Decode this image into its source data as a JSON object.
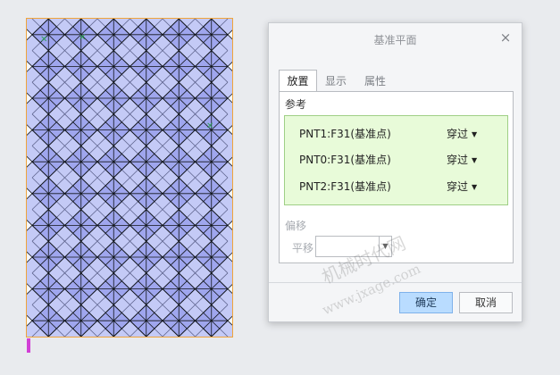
{
  "dialog": {
    "title": "基准平面",
    "close_glyph": "×",
    "tabs": [
      {
        "label": "放置",
        "active": true
      },
      {
        "label": "显示",
        "active": false
      },
      {
        "label": "属性",
        "active": false
      }
    ],
    "reference_section_label": "参考",
    "references": [
      {
        "name": "PNT1:F31(基准点)",
        "constraint": "穿过"
      },
      {
        "name": "PNT0:F31(基准点)",
        "constraint": "穿过"
      },
      {
        "name": "PNT2:F31(基准点)",
        "constraint": "穿过"
      }
    ],
    "offset_section_label": "偏移",
    "translate_label": "平移",
    "translate_value": "",
    "ok_label": "确定",
    "cancel_label": "取消"
  },
  "watermark": {
    "text_cn": "机械时代网",
    "url": "www.jxage.com"
  },
  "pattern": {
    "fill_color": "#9fa6ee",
    "highlight_color": "#f2f5ff",
    "line_color": "#101418",
    "frame_color": "#f0a43a",
    "datum_mark_color": "#2f9f5a"
  },
  "icons": {
    "close": "close-icon",
    "dropdown": "chevron-down-icon",
    "datum_point": "datum-point-icon"
  }
}
